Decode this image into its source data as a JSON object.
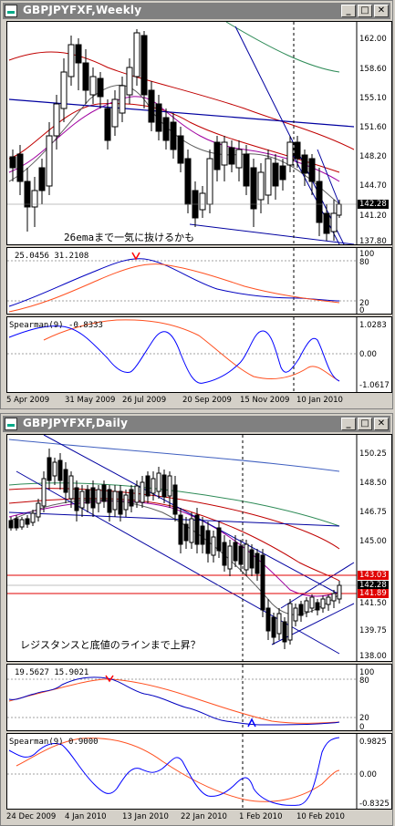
{
  "weekly": {
    "title": "GBPJPYFXF,Weekly",
    "buttons": {
      "min": "_",
      "max": "□",
      "close": "✕"
    },
    "price_axis": [
      "162.00",
      "158.60",
      "155.10",
      "151.60",
      "148.20",
      "144.70",
      "141.20",
      "137.80"
    ],
    "current_price": "142.28",
    "annotation": "26emaまで一気に抜けるかも",
    "stoch": {
      "header": "25.0456 31.2108",
      "axis": [
        "100",
        "80",
        "20",
        "0"
      ]
    },
    "spearman": {
      "header": "Spearman(9) -0.8333",
      "axis": [
        "1.0283",
        "0.00",
        "-1.0617"
      ]
    },
    "x_axis": [
      "5 Apr 2009",
      "31 May 2009",
      "26 Jul 2009",
      "20 Sep 2009",
      "15 Nov 2009",
      "10 Jan 2010"
    ]
  },
  "daily": {
    "title": "GBPJPYFXF,Daily",
    "buttons": {
      "min": "_",
      "max": "□",
      "close": "✕"
    },
    "price_axis": [
      "150.25",
      "148.50",
      "146.75",
      "145.00",
      "141.50",
      "139.75",
      "138.00"
    ],
    "price_labels": {
      "resistance": "143.03",
      "current": "142.28",
      "support": "141.89"
    },
    "annotation": "レジスタンスと底値のラインまで上昇？",
    "stoch": {
      "header": "19.5627 15.9021",
      "axis": [
        "100",
        "80",
        "20",
        "0"
      ]
    },
    "spearman": {
      "header": "Spearman(9) 0.9000",
      "axis": [
        "0.9825",
        "0.00",
        "-0.8325"
      ]
    },
    "x_axis": [
      "24 Dec 2009",
      "4 Jan 2010",
      "13 Jan 2010",
      "22 Jan 2010",
      "1 Feb 2010",
      "10 Feb 2010"
    ]
  },
  "colors": {
    "up": "#ffffff",
    "down": "#000000",
    "stoch_main": "#0000c0",
    "stoch_signal": "#ff5020",
    "spearman": "#0000ff",
    "red_line": "#e00000",
    "signal_arrow_down": "#ff0000",
    "signal_arrow_up": "#0000ff"
  }
}
